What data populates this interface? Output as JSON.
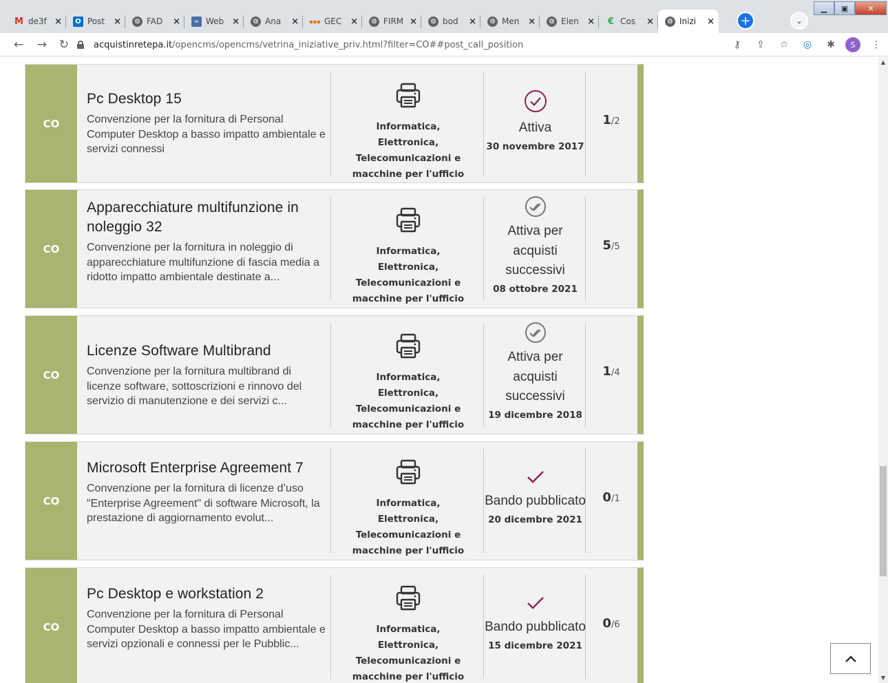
{
  "browser": {
    "tabs": [
      {
        "title": "de3f",
        "icon": "gmail-icon",
        "glyph": "M"
      },
      {
        "title": "Post",
        "icon": "outlook-icon",
        "glyph": "O"
      },
      {
        "title": "FAD",
        "icon": "globe-icon",
        "glyph": "◍"
      },
      {
        "title": "Web",
        "icon": "web-icon",
        "glyph": "═"
      },
      {
        "title": "Ana",
        "icon": "globe-icon",
        "glyph": "◍"
      },
      {
        "title": "GEC",
        "icon": "gec-icon",
        "glyph": "▪▪▪"
      },
      {
        "title": "FIRM",
        "icon": "globe-icon",
        "glyph": "◍"
      },
      {
        "title": "bod",
        "icon": "globe-icon",
        "glyph": "◍"
      },
      {
        "title": "Men",
        "icon": "globe-icon",
        "glyph": "◍"
      },
      {
        "title": "Elen",
        "icon": "globe-icon",
        "glyph": "◍"
      },
      {
        "title": "Cos",
        "icon": "cos-icon",
        "glyph": "€"
      },
      {
        "title": "Inizi",
        "icon": "globe-icon",
        "glyph": "◍",
        "active": true
      }
    ],
    "url_host": "acquistinretepa.it",
    "url_path": "/opencms/opencms/vetrina_iniziative_priv.html?filter=CO##post_call_position",
    "profile_initial": "S"
  },
  "colors": {
    "card_accent": "#a8b46f",
    "status_icon": "#8b2252"
  },
  "cards": [
    {
      "type": "CO",
      "title": "Pc Desktop 15",
      "description": "Convenzione per la fornitura di Personal Computer Desktop a basso impatto ambientale e servizi connessi",
      "category": "Informatica, Elettronica, Telecomunicazioni e macchine per l'ufficio",
      "status_icon": "check-circle-icon",
      "status": "Attiva",
      "date": "30 novembre 2017",
      "count": "1",
      "total": "/2"
    },
    {
      "type": "CO",
      "title": "Apparecchiature multifunzione in noleggio 32",
      "description": "Convenzione per la fornitura in noleggio di apparecchiature multifunzione di fascia media a ridotto impatto ambientale destinate a...",
      "category": "Informatica, Elettronica, Telecomunicazioni e macchine per l'ufficio",
      "status_icon": "double-check-circle-icon",
      "status": "Attiva per acquisti successivi",
      "date": "08 ottobre 2021",
      "count": "5",
      "total": "/5"
    },
    {
      "type": "CO",
      "title": "Licenze Software Multibrand",
      "description": "Convenzione per la fornitura multibrand di licenze software, sottoscrizioni e rinnovo del servizio di manutenzione e dei servizi c...",
      "category": "Informatica, Elettronica, Telecomunicazioni e macchine per l'ufficio",
      "status_icon": "double-check-circle-icon",
      "status": "Attiva per acquisti successivi",
      "date": "19 dicembre 2018",
      "count": "1",
      "total": "/4"
    },
    {
      "type": "CO",
      "title": "Microsoft Enterprise Agreement 7",
      "description": "Convenzione per la fornitura di licenze d’uso \"Enterprise Agreement\" di software Microsoft, la prestazione di aggiornamento evolut...",
      "category": "Informatica, Elettronica, Telecomunicazioni e macchine per l'ufficio",
      "status_icon": "check-icon",
      "status": "Bando pubblicato",
      "date": "20 dicembre 2021",
      "count": "0",
      "total": "/1"
    },
    {
      "type": "CO",
      "title": "Pc Desktop e workstation 2",
      "description": "Convenzione per la fornitura di Personal Computer Desktop a basso impatto ambientale e servizi opzionali e connessi per le Pubblic...",
      "category": "Informatica, Elettronica, Telecomunicazioni e macchine per l'ufficio",
      "status_icon": "check-icon",
      "status": "Bando pubblicato",
      "date": "15 dicembre 2021",
      "count": "0",
      "total": "/6"
    }
  ]
}
